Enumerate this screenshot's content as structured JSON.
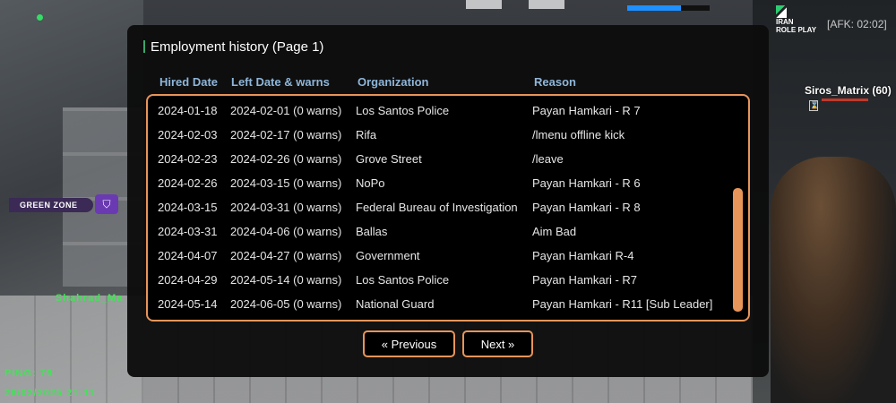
{
  "hud": {
    "afk": "[AFK: 02:02]",
    "logo_line1": "IRAN",
    "logo_line2": "ROLE PLAY",
    "player_name": "Siros_Matrix (60)",
    "zone": "GREEN ZONE",
    "world_name": "Shahrad_Ma",
    "ping": "PING: 79",
    "datetime": "28/02/2025 21:11"
  },
  "dialog": {
    "title": "Employment history (Page 1)",
    "columns": [
      "Hired Date",
      "Left Date & warns",
      "Organization",
      "Reason"
    ],
    "rows": [
      [
        "2024-01-18",
        "2024-02-01 (0 warns)",
        "Los Santos Police",
        "Payan Hamkari - R 7"
      ],
      [
        "2024-02-03",
        "2024-02-17 (0 warns)",
        "Rifa",
        "/lmenu offline kick"
      ],
      [
        "2024-02-23",
        "2024-02-26 (0 warns)",
        "Grove Street",
        "/leave"
      ],
      [
        "2024-02-26",
        "2024-03-15 (0 warns)",
        "NoPo",
        "Payan Hamkari - R 6"
      ],
      [
        "2024-03-15",
        "2024-03-31 (0 warns)",
        "Federal Bureau of Investigation",
        "Payan Hamkari - R 8"
      ],
      [
        "2024-03-31",
        "2024-04-06 (0 warns)",
        "Ballas",
        "Aim Bad"
      ],
      [
        "2024-04-07",
        "2024-04-27 (0 warns)",
        "Government",
        "Payan Hamkari R-4"
      ],
      [
        "2024-04-29",
        "2024-05-14 (0 warns)",
        "Los Santos Police",
        "Payan Hamkari - R7"
      ],
      [
        "2024-05-14",
        "2024-06-05 (0 warns)",
        "National Guard",
        "Payan Hamkari - R11 [Sub Leader]"
      ]
    ],
    "buttons": {
      "previous": "« Previous",
      "next": "Next »"
    },
    "accent_color": "#e8955a"
  }
}
